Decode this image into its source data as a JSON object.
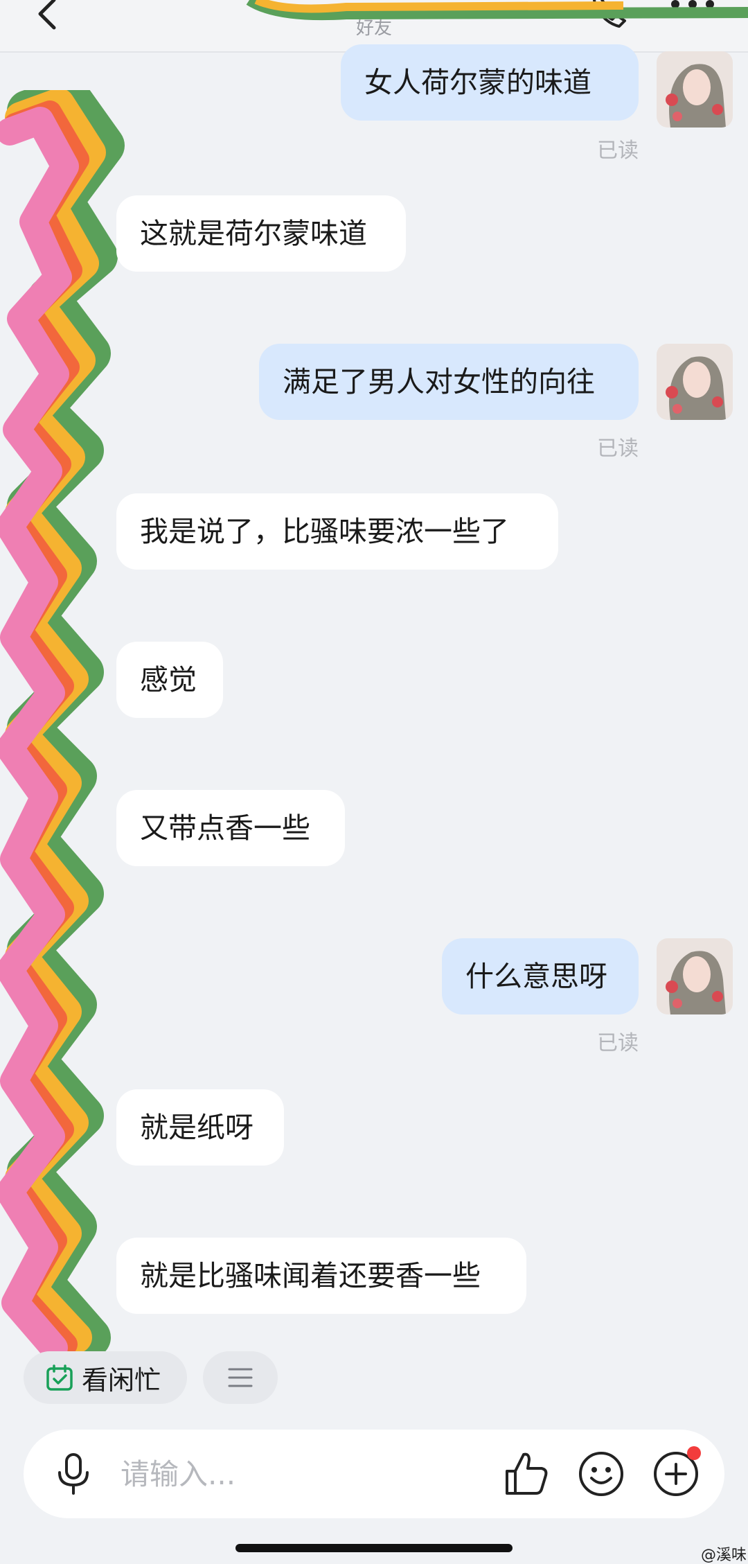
{
  "header": {
    "subtitle": "好友"
  },
  "messages": [
    {
      "direction": "out",
      "text": "女人荷尔蒙的味道",
      "status": "已读"
    },
    {
      "direction": "in",
      "text": "这就是荷尔蒙味道"
    },
    {
      "direction": "out",
      "text": "满足了男人对女性的向往",
      "status": "已读"
    },
    {
      "direction": "in",
      "text": "我是说了，比骚味要浓一些了"
    },
    {
      "direction": "in",
      "text": "感觉"
    },
    {
      "direction": "in",
      "text": "又带点香一些"
    },
    {
      "direction": "out",
      "text": "什么意思呀",
      "status": "已读"
    },
    {
      "direction": "in",
      "text": "就是纸呀"
    },
    {
      "direction": "in",
      "text": "就是比骚味闻着还要香一些"
    }
  ],
  "quick_actions": {
    "busy_label": "看闲忙",
    "busy_icon": "calendar-check-icon",
    "menu_icon": "menu-lines-icon"
  },
  "input": {
    "placeholder": "请输入..."
  },
  "icons": {
    "back": "back-arrow-icon",
    "call": "phone-icon",
    "more": "more-dots-icon",
    "mic": "microphone-icon",
    "like": "thumbs-up-icon",
    "emoji": "smile-icon",
    "plus": "plus-circle-icon"
  },
  "colors": {
    "background": "#f0f2f5",
    "incoming_bubble": "#ffffff",
    "outgoing_bubble": "#d8e8fd",
    "read_text": "#b3b5ba",
    "accent_green": "#18a058",
    "notification_dot": "#f23c3c"
  },
  "watermark": "@溪味"
}
